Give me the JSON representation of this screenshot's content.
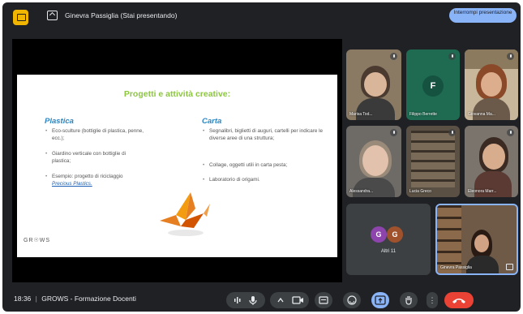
{
  "topbar": {
    "presenter_label": "Ginevra Passiglia (Stai presentando)",
    "stop_presenting_label": "Interrompi presentazione"
  },
  "slide": {
    "title": "Progetti e attività creative:",
    "left_title": "Plastica",
    "left_items": [
      "Eco-sculture (bottiglie di plastica, penne, ecc.);",
      "Giardino verticale con bottiglie di plastica;",
      "Esempio: progetto di riciclaggio"
    ],
    "left_link": "Precious Plastics.",
    "right_title": "Carta",
    "right_items": [
      "Segnalibri, biglietti di auguri, cartelli per indicare le diverse aree di una struttura;",
      "Collage, oggetti utili in carta pesta;",
      "Laboratorio di origami."
    ],
    "logo_text": "GR☉WS"
  },
  "participants": [
    {
      "name": "Marisa Tod...",
      "kind": "video"
    },
    {
      "name": "Filippo Berrette",
      "kind": "avatar",
      "letter": "F",
      "color": "#1e6b52"
    },
    {
      "name": "Giovanna Ma...",
      "kind": "video"
    },
    {
      "name": "Alessandra...",
      "kind": "video"
    },
    {
      "name": "Lucia Greco",
      "kind": "video"
    },
    {
      "name": "Eleonora Marr...",
      "kind": "video"
    },
    {
      "name": "Altri 11",
      "kind": "others",
      "letters": [
        "G",
        "G"
      ]
    },
    {
      "name": "Ginevra Passiglia",
      "kind": "self"
    }
  ],
  "bottombar": {
    "time": "18:36",
    "separator": "|",
    "meeting_name": "GROWS - Formazione Docenti"
  },
  "icons": {
    "more": "⋮"
  },
  "colors": {
    "background": "#202124",
    "accent": "#8ab4f8",
    "end_call": "#ea4335",
    "slide_title": "#8cc63f",
    "slide_heading": "#2e86c1"
  }
}
